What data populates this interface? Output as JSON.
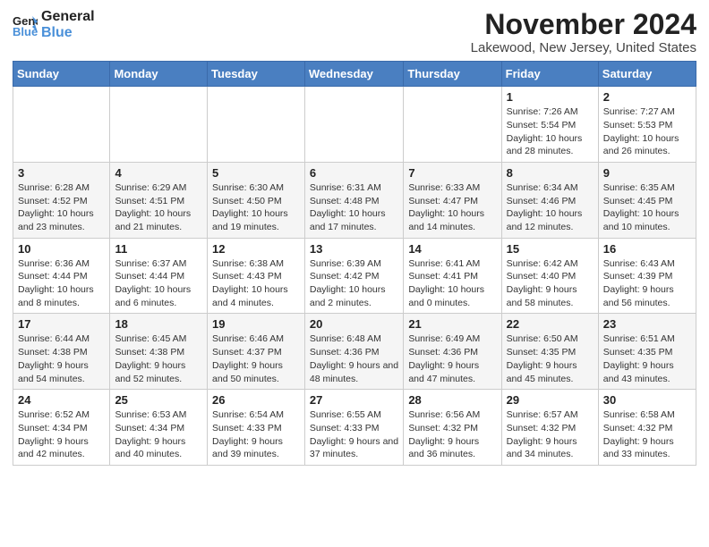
{
  "logo": {
    "line1": "General",
    "line2": "Blue"
  },
  "title": "November 2024",
  "location": "Lakewood, New Jersey, United States",
  "days_of_week": [
    "Sunday",
    "Monday",
    "Tuesday",
    "Wednesday",
    "Thursday",
    "Friday",
    "Saturday"
  ],
  "weeks": [
    [
      {
        "day": "",
        "info": ""
      },
      {
        "day": "",
        "info": ""
      },
      {
        "day": "",
        "info": ""
      },
      {
        "day": "",
        "info": ""
      },
      {
        "day": "",
        "info": ""
      },
      {
        "day": "1",
        "info": "Sunrise: 7:26 AM\nSunset: 5:54 PM\nDaylight: 10 hours and 28 minutes."
      },
      {
        "day": "2",
        "info": "Sunrise: 7:27 AM\nSunset: 5:53 PM\nDaylight: 10 hours and 26 minutes."
      }
    ],
    [
      {
        "day": "3",
        "info": "Sunrise: 6:28 AM\nSunset: 4:52 PM\nDaylight: 10 hours and 23 minutes."
      },
      {
        "day": "4",
        "info": "Sunrise: 6:29 AM\nSunset: 4:51 PM\nDaylight: 10 hours and 21 minutes."
      },
      {
        "day": "5",
        "info": "Sunrise: 6:30 AM\nSunset: 4:50 PM\nDaylight: 10 hours and 19 minutes."
      },
      {
        "day": "6",
        "info": "Sunrise: 6:31 AM\nSunset: 4:48 PM\nDaylight: 10 hours and 17 minutes."
      },
      {
        "day": "7",
        "info": "Sunrise: 6:33 AM\nSunset: 4:47 PM\nDaylight: 10 hours and 14 minutes."
      },
      {
        "day": "8",
        "info": "Sunrise: 6:34 AM\nSunset: 4:46 PM\nDaylight: 10 hours and 12 minutes."
      },
      {
        "day": "9",
        "info": "Sunrise: 6:35 AM\nSunset: 4:45 PM\nDaylight: 10 hours and 10 minutes."
      }
    ],
    [
      {
        "day": "10",
        "info": "Sunrise: 6:36 AM\nSunset: 4:44 PM\nDaylight: 10 hours and 8 minutes."
      },
      {
        "day": "11",
        "info": "Sunrise: 6:37 AM\nSunset: 4:44 PM\nDaylight: 10 hours and 6 minutes."
      },
      {
        "day": "12",
        "info": "Sunrise: 6:38 AM\nSunset: 4:43 PM\nDaylight: 10 hours and 4 minutes."
      },
      {
        "day": "13",
        "info": "Sunrise: 6:39 AM\nSunset: 4:42 PM\nDaylight: 10 hours and 2 minutes."
      },
      {
        "day": "14",
        "info": "Sunrise: 6:41 AM\nSunset: 4:41 PM\nDaylight: 10 hours and 0 minutes."
      },
      {
        "day": "15",
        "info": "Sunrise: 6:42 AM\nSunset: 4:40 PM\nDaylight: 9 hours and 58 minutes."
      },
      {
        "day": "16",
        "info": "Sunrise: 6:43 AM\nSunset: 4:39 PM\nDaylight: 9 hours and 56 minutes."
      }
    ],
    [
      {
        "day": "17",
        "info": "Sunrise: 6:44 AM\nSunset: 4:38 PM\nDaylight: 9 hours and 54 minutes."
      },
      {
        "day": "18",
        "info": "Sunrise: 6:45 AM\nSunset: 4:38 PM\nDaylight: 9 hours and 52 minutes."
      },
      {
        "day": "19",
        "info": "Sunrise: 6:46 AM\nSunset: 4:37 PM\nDaylight: 9 hours and 50 minutes."
      },
      {
        "day": "20",
        "info": "Sunrise: 6:48 AM\nSunset: 4:36 PM\nDaylight: 9 hours and 48 minutes."
      },
      {
        "day": "21",
        "info": "Sunrise: 6:49 AM\nSunset: 4:36 PM\nDaylight: 9 hours and 47 minutes."
      },
      {
        "day": "22",
        "info": "Sunrise: 6:50 AM\nSunset: 4:35 PM\nDaylight: 9 hours and 45 minutes."
      },
      {
        "day": "23",
        "info": "Sunrise: 6:51 AM\nSunset: 4:35 PM\nDaylight: 9 hours and 43 minutes."
      }
    ],
    [
      {
        "day": "24",
        "info": "Sunrise: 6:52 AM\nSunset: 4:34 PM\nDaylight: 9 hours and 42 minutes."
      },
      {
        "day": "25",
        "info": "Sunrise: 6:53 AM\nSunset: 4:34 PM\nDaylight: 9 hours and 40 minutes."
      },
      {
        "day": "26",
        "info": "Sunrise: 6:54 AM\nSunset: 4:33 PM\nDaylight: 9 hours and 39 minutes."
      },
      {
        "day": "27",
        "info": "Sunrise: 6:55 AM\nSunset: 4:33 PM\nDaylight: 9 hours and 37 minutes."
      },
      {
        "day": "28",
        "info": "Sunrise: 6:56 AM\nSunset: 4:32 PM\nDaylight: 9 hours and 36 minutes."
      },
      {
        "day": "29",
        "info": "Sunrise: 6:57 AM\nSunset: 4:32 PM\nDaylight: 9 hours and 34 minutes."
      },
      {
        "day": "30",
        "info": "Sunrise: 6:58 AM\nSunset: 4:32 PM\nDaylight: 9 hours and 33 minutes."
      }
    ]
  ]
}
